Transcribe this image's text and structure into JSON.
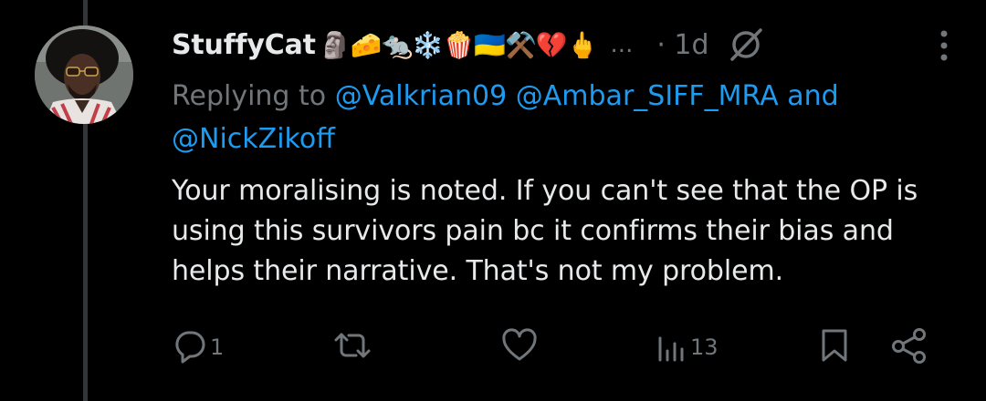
{
  "author": {
    "display_name": "StuffyCat",
    "name_emojis": "🗿🧀🐀❄️🍿🇺🇦⚒️💔🖕",
    "name_overflow": "...",
    "time_ago": "· 1d"
  },
  "reply": {
    "prefix": "Replying to",
    "mention_1": "@Valkrian09",
    "mention_2": "@Ambar_SIFF_MRA",
    "conjunction": "and",
    "mention_3": "@NickZikoff"
  },
  "body": "Your moralising is noted. If you can't see that the OP is using this survivors pain bc it confirms their bias and helps their narrative. That's not my problem.",
  "actions": {
    "replies": "1",
    "retweets": "",
    "likes": "",
    "views": "13"
  },
  "colors": {
    "background": "#000000",
    "text_primary": "#e7e9ea",
    "text_secondary": "#71767b",
    "link": "#1d9bf0",
    "thread_line": "#333639"
  },
  "icons": [
    "grok-icon",
    "more-icon",
    "reply-icon",
    "retweet-icon",
    "like-icon",
    "views-icon",
    "bookmark-icon",
    "share-icon"
  ]
}
